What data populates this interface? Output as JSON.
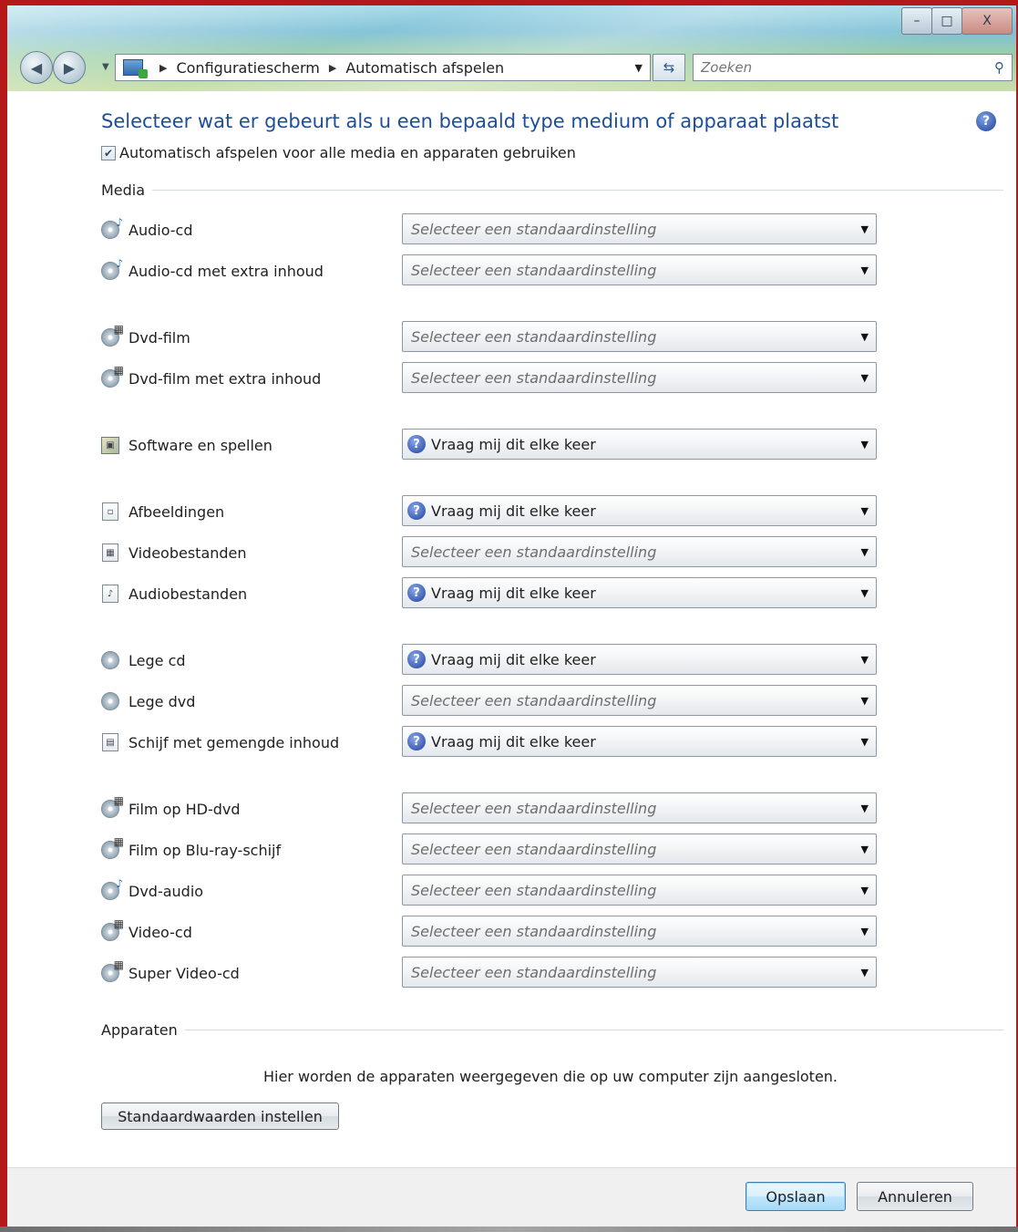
{
  "window": {
    "title_buttons": {
      "minimize": "–",
      "maximize": "□",
      "close": "X"
    }
  },
  "nav": {
    "breadcrumb": [
      "Configuratiescherm",
      "Automatisch afspelen"
    ],
    "search_placeholder": "Zoeken"
  },
  "page": {
    "title": "Selecteer wat er gebeurt als u een bepaald type medium of apparaat plaatst",
    "use_autoplay_label": "Automatisch afspelen voor alle media en apparaten gebruiken",
    "use_autoplay_checked": true,
    "media_heading": "Media",
    "devices_heading": "Apparaten",
    "devices_note": "Hier worden de apparaten weergegeven die op uw computer zijn aangesloten.",
    "reset_button": "Standaardwaarden instellen"
  },
  "dropdown_texts": {
    "placeholder": "Selecteer een standaardinstelling",
    "ask": "Vraag mij dit elke keer"
  },
  "media_items": [
    {
      "label": "Audio-cd",
      "icon": "audio-cd-icon",
      "value": "Selecteer een standaardinstelling",
      "is_placeholder": true
    },
    {
      "label": "Audio-cd met extra inhoud",
      "icon": "audio-cd-icon",
      "value": "Selecteer een standaardinstelling",
      "is_placeholder": true
    },
    {
      "label": "Dvd-film",
      "icon": "dvd-film-icon",
      "value": "Selecteer een standaardinstelling",
      "is_placeholder": true
    },
    {
      "label": "Dvd-film met extra inhoud",
      "icon": "dvd-film-icon",
      "value": "Selecteer een standaardinstelling",
      "is_placeholder": true
    },
    {
      "label": "Software en spellen",
      "icon": "software-icon",
      "value": "Vraag mij dit elke keer",
      "is_placeholder": false
    },
    {
      "label": "Afbeeldingen",
      "icon": "image-file-icon",
      "value": "Vraag mij dit elke keer",
      "is_placeholder": false
    },
    {
      "label": "Videobestanden",
      "icon": "video-file-icon",
      "value": "Selecteer een standaardinstelling",
      "is_placeholder": true
    },
    {
      "label": "Audiobestanden",
      "icon": "audio-file-icon",
      "value": "Vraag mij dit elke keer",
      "is_placeholder": false
    },
    {
      "label": "Lege cd",
      "icon": "blank-disc-icon",
      "value": "Vraag mij dit elke keer",
      "is_placeholder": false
    },
    {
      "label": "Lege dvd",
      "icon": "blank-disc-icon",
      "value": "Selecteer een standaardinstelling",
      "is_placeholder": true
    },
    {
      "label": "Schijf met gemengde inhoud",
      "icon": "mixed-content-icon",
      "value": "Vraag mij dit elke keer",
      "is_placeholder": false
    },
    {
      "label": "Film op HD-dvd",
      "icon": "dvd-film-icon",
      "value": "Selecteer een standaardinstelling",
      "is_placeholder": true
    },
    {
      "label": "Film op Blu-ray-schijf",
      "icon": "dvd-film-icon",
      "value": "Selecteer een standaardinstelling",
      "is_placeholder": true
    },
    {
      "label": "Dvd-audio",
      "icon": "audio-cd-icon",
      "value": "Selecteer een standaardinstelling",
      "is_placeholder": true
    },
    {
      "label": "Video-cd",
      "icon": "dvd-film-icon",
      "value": "Selecteer een standaardinstelling",
      "is_placeholder": true
    },
    {
      "label": "Super Video-cd",
      "icon": "dvd-film-icon",
      "value": "Selecteer een standaardinstelling",
      "is_placeholder": true
    }
  ],
  "footer": {
    "save_label": "Opslaan",
    "cancel_label": "Annuleren"
  }
}
